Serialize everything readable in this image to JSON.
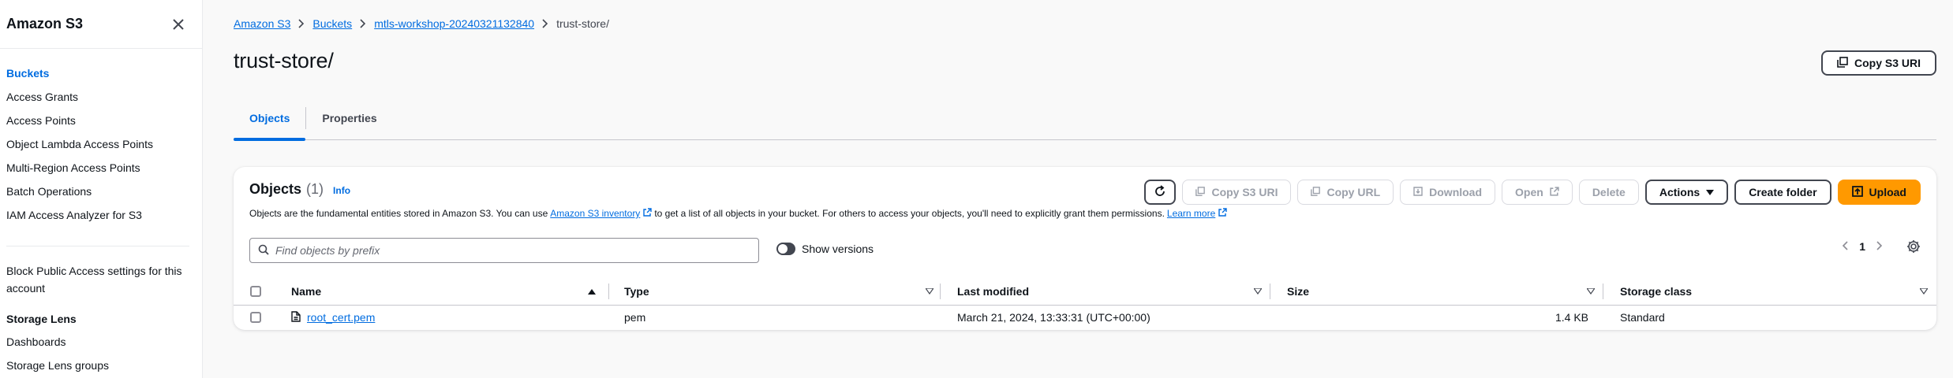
{
  "sidebar": {
    "title": "Amazon S3",
    "items": [
      {
        "label": "Buckets"
      },
      {
        "label": "Access Grants"
      },
      {
        "label": "Access Points"
      },
      {
        "label": "Object Lambda Access Points"
      },
      {
        "label": "Multi-Region Access Points"
      },
      {
        "label": "Batch Operations"
      },
      {
        "label": "IAM Access Analyzer for S3"
      }
    ],
    "block_public_access": "Block Public Access settings for this account",
    "storage_lens": {
      "heading": "Storage Lens",
      "items": [
        {
          "label": "Dashboards"
        },
        {
          "label": "Storage Lens groups"
        }
      ]
    }
  },
  "breadcrumb": {
    "items": [
      "Amazon S3",
      "Buckets",
      "mtls-workshop-20240321132840"
    ],
    "current": "trust-store/"
  },
  "page": {
    "title": "trust-store/",
    "copy_s3_uri": "Copy S3 URI"
  },
  "tabs": [
    {
      "label": "Objects"
    },
    {
      "label": "Properties"
    }
  ],
  "objects_panel": {
    "title": "Objects",
    "count": "(1)",
    "info": "Info",
    "desc_prefix": "Objects are the fundamental entities stored in Amazon S3. You can use",
    "inventory_link": "Amazon S3 inventory",
    "desc_middle": "to get a list of all objects in your bucket. For others to access your objects, you'll need to explicitly grant them permissions.",
    "learn_more": "Learn more",
    "buttons": {
      "copy_s3_uri": "Copy S3 URI",
      "copy_url": "Copy URL",
      "download": "Download",
      "open": "Open",
      "delete": "Delete",
      "actions": "Actions",
      "create_folder": "Create folder",
      "upload": "Upload"
    },
    "search_placeholder": "Find objects by prefix",
    "show_versions": "Show versions",
    "page_number": "1",
    "columns": [
      "Name",
      "Type",
      "Last modified",
      "Size",
      "Storage class"
    ],
    "rows": [
      {
        "name": "root_cert.pem",
        "type": "pem",
        "last_modified": "March 21, 2024, 13:33:31 (UTC+00:00)",
        "size": "1.4 KB",
        "storage_class": "Standard"
      }
    ]
  },
  "colors": {
    "accent": "#006ce0",
    "primary": "#ff9900",
    "text": "#0f141a"
  }
}
